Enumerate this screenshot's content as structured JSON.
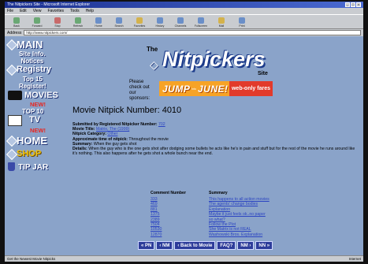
{
  "window": {
    "title": "The Nitpickers Site - Microsoft Internet Explorer",
    "buttons": [
      "_",
      "□",
      "×"
    ]
  },
  "menu": [
    "File",
    "Edit",
    "View",
    "Favorites",
    "Tools",
    "Help"
  ],
  "toolbar": [
    {
      "label": "Back",
      "icon": "back-icon"
    },
    {
      "label": "Forward",
      "icon": "forward-icon"
    },
    {
      "label": "Stop",
      "icon": "stop-icon"
    },
    {
      "label": "Refresh",
      "icon": "refresh-icon"
    },
    {
      "label": "Home",
      "icon": "home-icon"
    },
    {
      "label": "Search",
      "icon": "search-icon"
    },
    {
      "label": "Favorites",
      "icon": "favorites-icon"
    },
    {
      "label": "History",
      "icon": "history-icon"
    },
    {
      "label": "Channels",
      "icon": "channels-icon"
    },
    {
      "label": "Fullscreen",
      "icon": "fullscreen-icon"
    },
    {
      "label": "Mail",
      "icon": "mail-icon"
    },
    {
      "label": "Print",
      "icon": "print-icon"
    }
  ],
  "address": {
    "label": "Address",
    "value": "http://www.nitpickers.com/"
  },
  "nav": {
    "main": "MAIN",
    "site_info": "Site Info.",
    "notices": "Notices",
    "registry": "Registry",
    "top15": "Top 15",
    "register": "Register!",
    "movies": "MOVIES",
    "movies_new": "NEW!",
    "top10": "TOP 10",
    "tv": "TV",
    "tv_new": "NEW!",
    "home": "HOME",
    "shop": "SHOP",
    "tipjar": "TIP JAR"
  },
  "logo": {
    "the": "The",
    "name": "Nitpickers",
    "site": "Site"
  },
  "sponsor": {
    "line1": "Please",
    "line2": "check out",
    "line3": "our",
    "line4": "sponsors:",
    "banner_big": "JUMP",
    "banner_small": "into",
    "banner_big2": "JUNE!",
    "banner_rest": "web-only fares"
  },
  "nitpick": {
    "heading": "Movie Nitpick Number: 4010",
    "submitted_label": "Submitted by Registered Nitpicker Number:",
    "submitted_value": "702",
    "title_label": "Movie Title:",
    "title_value": "Matrix, The (1999)",
    "category_label": "Nitpick Category:",
    "category_value": "Other",
    "time_label": "Approximate time of nitpick:",
    "time_value": "Throughout the movie",
    "summary_label": "Summary:",
    "summary_value": "When the guy gets shot",
    "details_label": "Details:",
    "details_value": "When the guy who is the one gets shot after dodging some bullets he acts like he's in pain and stuff but for the rest of the movie he runs around like it's nothing. This also happens after he gets shot a whole bunch near the end."
  },
  "comments": {
    "col_number": "Comment Number",
    "col_summary": "Summary",
    "rows": [
      {
        "num": "333",
        "summary": "This happens to all action movies"
      },
      {
        "num": "469",
        "summary": "The agents' change bodies"
      },
      {
        "num": "881",
        "summary": "Explanation"
      },
      {
        "num": "1375",
        "summary": "Maybe it just feels ok..no paper"
      },
      {
        "num": "2389",
        "summary": "so what?"
      },
      {
        "num": "7504",
        "summary": "Follow the Plot"
      },
      {
        "num": "10530",
        "summary": "She Matrix is not REAL"
      },
      {
        "num": "12870",
        "summary": "Washowski Bros. Explanation"
      }
    ]
  },
  "bottom_nav": [
    "« PN",
    "‹ NM",
    "‹ Back to Movie",
    "FAQ?",
    "NM ›",
    "NN »"
  ],
  "status": {
    "left": "Get the Newest Movie Nitpicks",
    "right": "Internet"
  }
}
